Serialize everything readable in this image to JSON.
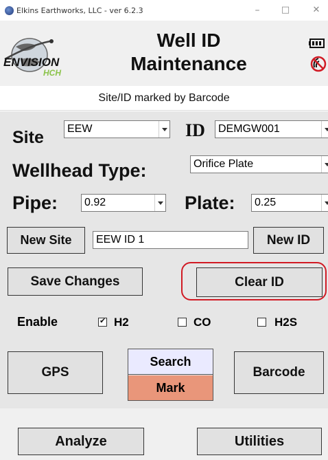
{
  "window": {
    "title": "Elkins Earthworks, LLC - ver 6.2.3",
    "minimize": "–",
    "maximize": "□",
    "close": "✕"
  },
  "header": {
    "title_line1": "Well ID",
    "title_line2": "Maintenance",
    "logo_text": "ENVISION",
    "logo_sub": "HCH",
    "icons": [
      "battery-icon",
      "no-signal-icon"
    ]
  },
  "subtitle": "Site/ID marked by Barcode",
  "form": {
    "site_label": "Site",
    "site_value": "EEW",
    "id_label": "ID",
    "id_value": "DEMGW001",
    "wellhead_label": "Wellhead Type:",
    "wellhead_value": "Orifice Plate",
    "pipe_label": "Pipe:",
    "pipe_value": "0.92",
    "plate_label": "Plate:",
    "plate_value": "0.25",
    "new_site_button": "New Site",
    "new_site_input": "EEW ID 1",
    "new_id_button": "New ID",
    "save_button": "Save Changes",
    "clear_button": "Clear ID",
    "enable_label": "Enable",
    "sensors": [
      {
        "label": "H2",
        "checked": true
      },
      {
        "label": "CO",
        "checked": false
      },
      {
        "label": "H2S",
        "checked": false
      }
    ],
    "gps_button": "GPS",
    "search_label": "Search",
    "mark_label": "Mark",
    "barcode_button": "Barcode"
  },
  "footer": {
    "analyze_button": "Analyze",
    "utilities_button": "Utilities"
  },
  "colors": {
    "highlight": "#d11a24",
    "mark_bg": "#e9967a",
    "search_bg": "#eaeaff",
    "logo_green": "#8bc34a"
  }
}
